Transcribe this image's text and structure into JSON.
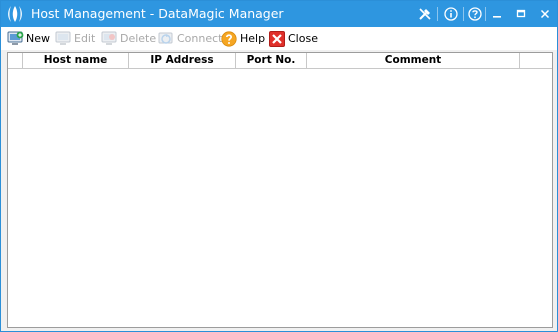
{
  "window": {
    "title": "Host Management - DataMagic Manager"
  },
  "titlebar_icons": [
    "tools-icon",
    "info-icon",
    "help-icon",
    "minimize-icon",
    "maximize-icon",
    "close-icon"
  ],
  "toolbar": {
    "new_label": "New",
    "edit_label": "Edit",
    "delete_label": "Delete",
    "connect_label": "Connect",
    "help_label": "Help",
    "close_label": "Close"
  },
  "grid": {
    "columns": [
      "Host name",
      "IP Address",
      "Port No.",
      "Comment"
    ],
    "rows": []
  },
  "colors": {
    "titlebar": "#2e96e0",
    "help_icon": "#f5a623",
    "close_icon": "#e0302a"
  }
}
